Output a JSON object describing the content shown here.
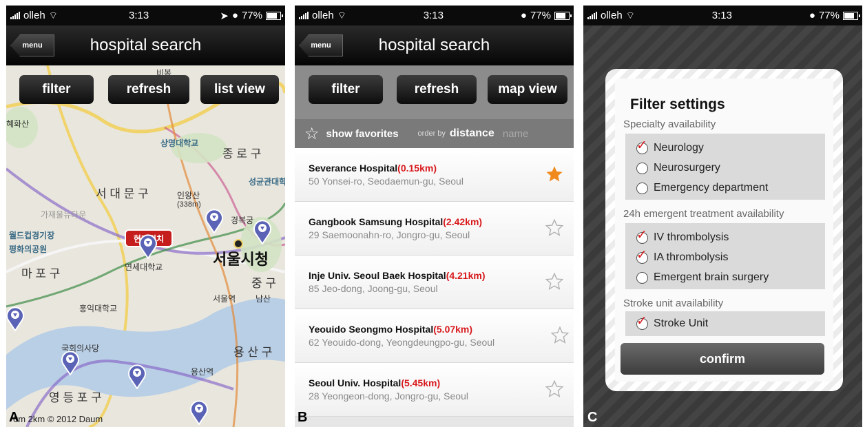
{
  "screens": {
    "a": {
      "status": {
        "carrier": "olleh",
        "time": "3:13",
        "battery": "77%"
      },
      "nav": {
        "menu_label": "menu",
        "title": "hospital search"
      },
      "toolbar": {
        "filter": "filter",
        "refresh": "refresh",
        "toggle": "list view"
      },
      "map": {
        "labels": [
          "비봉",
          "상명대학교",
          "종 로 구",
          "서 대 문 구",
          "인왕산",
          "(338m)",
          "성균관대학",
          "가재울뉴타운",
          "경복궁",
          "월드컵경기장",
          "평화의공원",
          "서울시청",
          "마 포 구",
          "연세대학교",
          "중 구",
          "서울역",
          "남산",
          "홍익대학교",
          "국회의사당",
          "용 산 구",
          "용산역",
          "영 등 포 구",
          "혜화산"
        ],
        "callout": "현재위치"
      },
      "copyright": "0m   2km      © 2012 Daum",
      "panel_letter": "A"
    },
    "b": {
      "status": {
        "carrier": "olleh",
        "time": "3:13",
        "battery": "77%"
      },
      "nav": {
        "menu_label": "menu",
        "title": "hospital search"
      },
      "toolbar": {
        "filter": "filter",
        "refresh": "refresh",
        "toggle": "map view"
      },
      "favorites": {
        "label": "show favorites",
        "order_by": "order by",
        "sort_distance": "distance",
        "sort_name": "name"
      },
      "hospitals": [
        {
          "name": "Severance Hospital",
          "distance": "(0.15km)",
          "address": "50 Yonsei-ro, Seodaemun-gu, Seoul",
          "favorite": true
        },
        {
          "name": "Gangbook Samsung Hospital",
          "distance": "(2.42km)",
          "address": "29 Saemoonahn-ro, Jongro-gu, Seoul",
          "favorite": false
        },
        {
          "name": "Inje Univ. Seoul Baek Hospital",
          "distance": "(4.21km)",
          "address": "85 Jeo-dong, Joong-gu, Seoul",
          "favorite": false
        },
        {
          "name": "Yeouido Seongmo Hospital",
          "distance": "(5.07km)",
          "address": "62 Yeouido-dong, Yeongdeungpo-gu, Seoul",
          "favorite": false
        },
        {
          "name": "Seoul Univ. Hospital",
          "distance": "(5.45km)",
          "address": "28 Yeongeon-dong, Jongro-gu, Seoul",
          "favorite": false
        }
      ],
      "panel_letter": "B"
    },
    "c": {
      "status": {
        "carrier": "olleh",
        "time": "3:13",
        "battery": "77%"
      },
      "title": "Filter settings",
      "sections": [
        {
          "label": "Specialty availability",
          "options": [
            {
              "label": "Neurology",
              "checked": true
            },
            {
              "label": "Neurosurgery",
              "checked": false
            },
            {
              "label": "Emergency department",
              "checked": false
            }
          ]
        },
        {
          "label": "24h emergent treatment availability",
          "options": [
            {
              "label": "IV thrombolysis",
              "checked": true
            },
            {
              "label": "IA thrombolysis",
              "checked": true
            },
            {
              "label": "Emergent brain surgery",
              "checked": false
            }
          ]
        },
        {
          "label": "Stroke unit availability",
          "options": [
            {
              "label": "Stroke Unit",
              "checked": true
            }
          ]
        }
      ],
      "confirm": "confirm",
      "panel_letter": "C"
    }
  },
  "colors": {
    "distance_red": "#d8191c",
    "favorite_orange": "#f08a1c",
    "pin_blue": "#5a63b5",
    "route_purple": "#8a6cc9"
  }
}
